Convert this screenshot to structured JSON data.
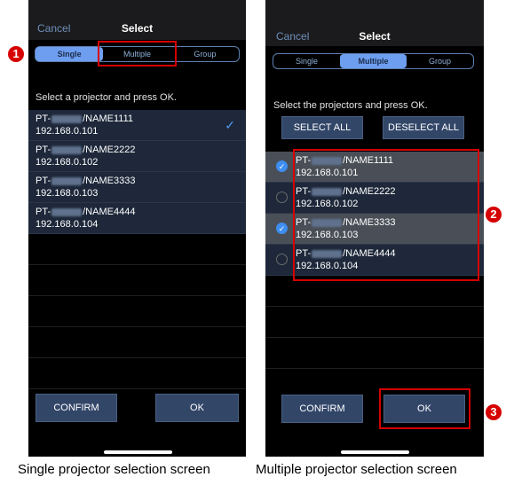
{
  "single_screen": {
    "nav": {
      "cancel_label": "Cancel",
      "title": "Select"
    },
    "segments": [
      {
        "label": "Single",
        "active": true
      },
      {
        "label": "Multiple",
        "active": false
      },
      {
        "label": "Group",
        "active": false
      }
    ],
    "prompt": "Select a projector and press OK.",
    "projectors": [
      {
        "prefix": "PT-",
        "name": "/NAME1111",
        "ip": "192.168.0.101",
        "selected": true
      },
      {
        "prefix": "PT-",
        "name": "/NAME2222",
        "ip": "192.168.0.102",
        "selected": false
      },
      {
        "prefix": "PT-",
        "name": "/NAME3333",
        "ip": "192.168.0.103",
        "selected": false
      },
      {
        "prefix": "PT-",
        "name": "/NAME4444",
        "ip": "192.168.0.104",
        "selected": false
      }
    ],
    "selected_icon": "checkmark-icon",
    "buttons": {
      "confirm": "CONFIRM",
      "ok": "OK"
    },
    "caption": "Single projector selection screen"
  },
  "multiple_screen": {
    "nav": {
      "cancel_label": "Cancel",
      "title": "Select"
    },
    "segments": [
      {
        "label": "Single",
        "active": false
      },
      {
        "label": "Multiple",
        "active": true
      },
      {
        "label": "Group",
        "active": false
      }
    ],
    "prompt": "Select the projectors and press OK.",
    "select_all_label": "SELECT ALL",
    "deselect_all_label": "DESELECT ALL",
    "projectors": [
      {
        "prefix": "PT-",
        "name": "/NAME1111",
        "ip": "192.168.0.101",
        "checked": true
      },
      {
        "prefix": "PT-",
        "name": "/NAME2222",
        "ip": "192.168.0.102",
        "checked": false
      },
      {
        "prefix": "PT-",
        "name": "/NAME3333",
        "ip": "192.168.0.103",
        "checked": true
      },
      {
        "prefix": "PT-",
        "name": "/NAME4444",
        "ip": "192.168.0.104",
        "checked": false
      }
    ],
    "buttons": {
      "confirm": "CONFIRM",
      "ok": "OK"
    },
    "caption": "Multiple projector selection screen"
  },
  "callouts": [
    "1",
    "2",
    "3"
  ],
  "colors": {
    "accent": "#6e9ef0",
    "checkbox": "#3d8ef0",
    "highlight": "#d60000",
    "button": "#324668"
  }
}
